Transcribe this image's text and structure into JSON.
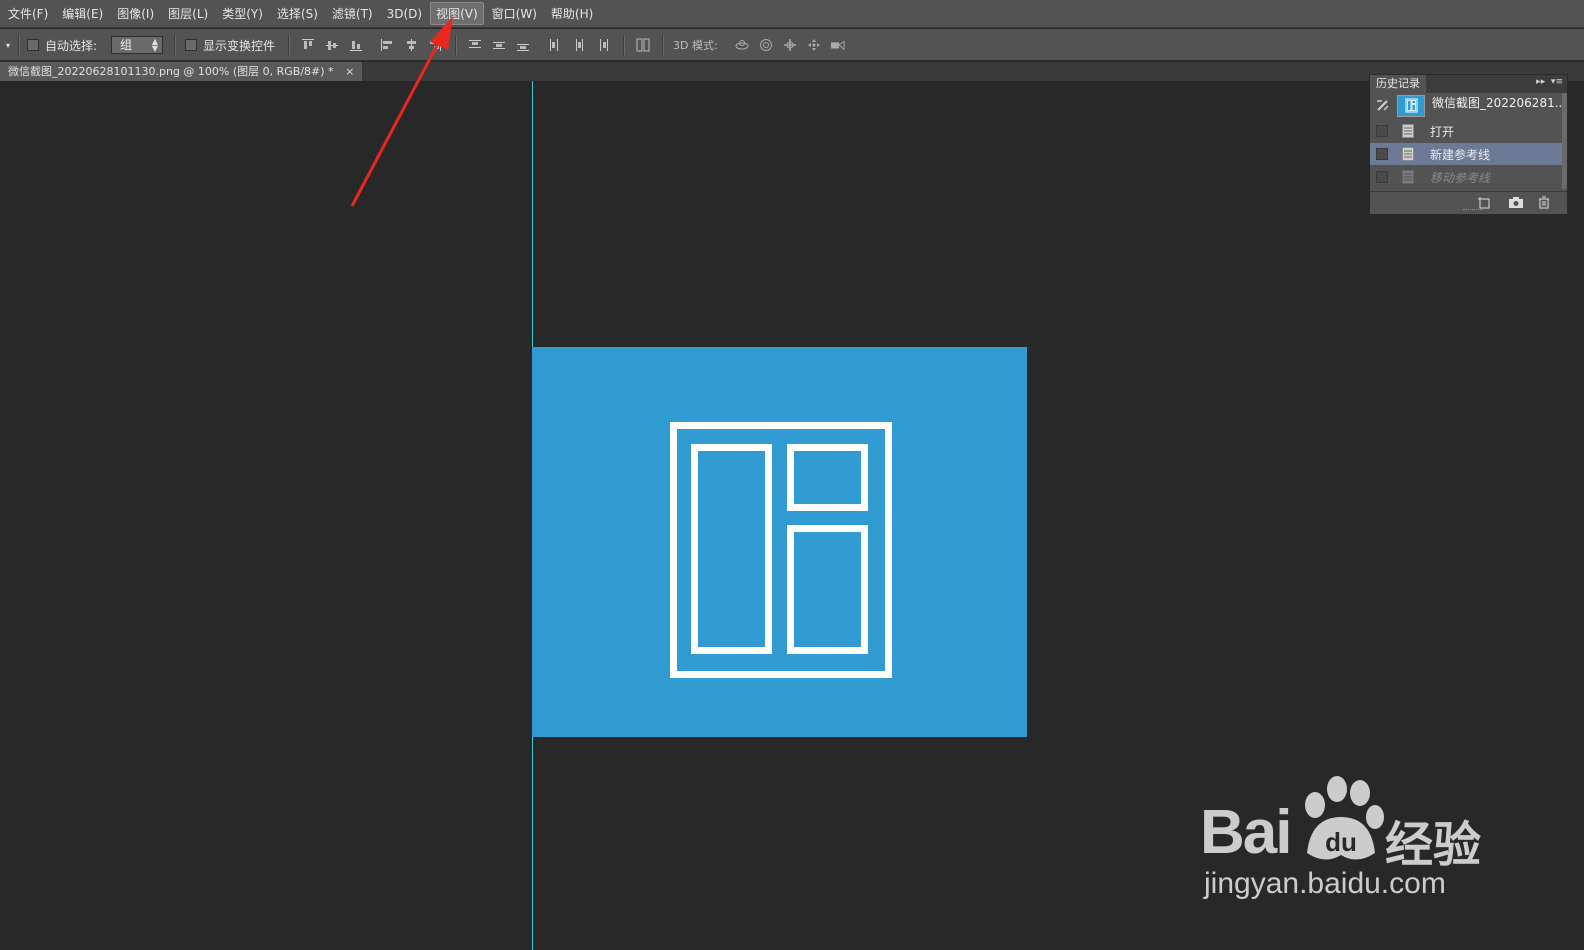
{
  "menubar": {
    "items": [
      {
        "label": "文件(F)"
      },
      {
        "label": "编辑(E)"
      },
      {
        "label": "图像(I)"
      },
      {
        "label": "图层(L)"
      },
      {
        "label": "类型(Y)"
      },
      {
        "label": "选择(S)"
      },
      {
        "label": "滤镜(T)"
      },
      {
        "label": "3D(D)"
      },
      {
        "label": "视图(V)",
        "active": true
      },
      {
        "label": "窗口(W)"
      },
      {
        "label": "帮助(H)"
      }
    ]
  },
  "options": {
    "auto_select_label": "自动选择:",
    "auto_select_value": "组",
    "show_transform_label": "显示变换控件",
    "mode_3d_label": "3D 模式:"
  },
  "document_tab": {
    "title": "微信截图_20220628101130.png @ 100% (图层 0, RGB/8#) *",
    "close": "×"
  },
  "history_panel": {
    "title": "历史记录",
    "snapshot_name": "微信截图_202206281...",
    "steps": [
      {
        "label": "打开",
        "state": "normal"
      },
      {
        "label": "新建参考线",
        "state": "selected"
      },
      {
        "label": "移动参考线",
        "state": "undone"
      }
    ]
  },
  "colors": {
    "accent_image": "#2f9bd0",
    "guide": "#35c8d4",
    "arrow": "#e8281e"
  },
  "watermark": {
    "brand": "Bai",
    "brand_suffix": "经验",
    "url": "jingyan.baidu.com"
  }
}
